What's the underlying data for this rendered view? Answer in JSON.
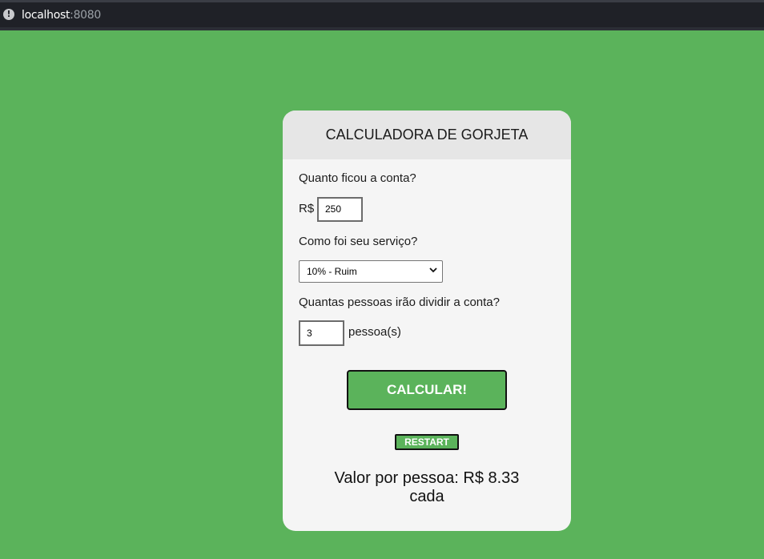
{
  "browser": {
    "host": "localhost",
    "port": ":8080",
    "info_icon": "info-circle-icon"
  },
  "card": {
    "title": "CALCULADORA DE GORJETA",
    "bill_question": "Quanto ficou a conta?",
    "currency_prefix": "R$",
    "bill_value": "250",
    "service_question": "Como foi seu serviço?",
    "service_selected": "10% - Ruim",
    "people_question": "Quantas pessoas irão dividir a conta?",
    "people_value": "3",
    "people_suffix": "pessoa(s)",
    "calc_label": "CALCULAR!",
    "restart_label": "RESTART",
    "result_line1": "Valor por pessoa: R$ 8.33",
    "result_line2": "cada"
  },
  "colors": {
    "background": "#5bb35b",
    "card": "#f5f5f5",
    "card_header": "#e6e6e6",
    "button": "#5bb35b"
  }
}
